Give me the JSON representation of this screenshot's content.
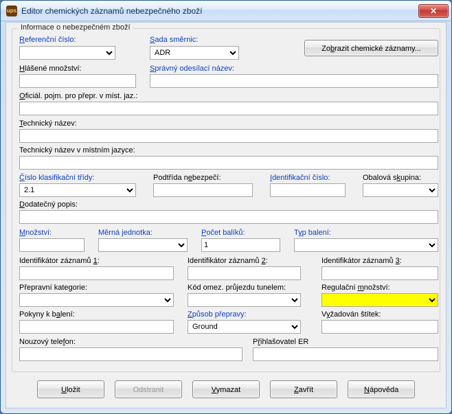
{
  "window": {
    "title": "Editor chemických záznamů nebezpečného zboží",
    "icon_text": "ups"
  },
  "group_legend": "Informace o nebezpečném zboží",
  "labels": {
    "ref_no": {
      "pre": "",
      "u": "R",
      "post": "eferenční číslo:"
    },
    "reg_set": {
      "pre": "",
      "u": "S",
      "post": "ada směrnic:"
    },
    "view_btn": {
      "pre": "Zo",
      "u": "b",
      "post": "razit chemické záznamy..."
    },
    "reported_qty": {
      "pre": "",
      "u": "H",
      "post": "lášené množství:"
    },
    "ship_name": {
      "pre": "",
      "u": "S",
      "post": "právný odesílací název:"
    },
    "local_name": "Oficiál. pojm. pro přepr. v míst. jaz.:",
    "tech_name": {
      "pre": "",
      "u": "T",
      "post": "echnický název:"
    },
    "tech_local": "Technický název v místním jazyce:",
    "class_no": {
      "pre": "",
      "u": "Č",
      "post": "íslo klasifikační třídy:"
    },
    "sub_risk": {
      "pre": "Podtřída n",
      "u": "e",
      "post": "bezpečí:"
    },
    "id_no": {
      "pre": "",
      "u": "I",
      "post": "dentifikační číslo:"
    },
    "pkg_group": {
      "pre": "Obalová s",
      "u": "k",
      "post": "upina:"
    },
    "add_desc": {
      "pre": "",
      "u": "D",
      "post": "odatečný popis:"
    },
    "qty": {
      "pre": "",
      "u": "M",
      "post": "nožství:"
    },
    "uom": {
      "pre": "Měrná ",
      "u": "j",
      "post": "ednotka:"
    },
    "pkg_count": {
      "pre": "",
      "u": "P",
      "post": "očet balíků:"
    },
    "pkg_type": {
      "pre": "T",
      "u": "y",
      "post": "p balení:"
    },
    "rec1": {
      "pre": "Identifikátor záznamů ",
      "u": "1",
      "post": ":"
    },
    "rec2": {
      "pre": "Identifikátor záznamů ",
      "u": "2",
      "post": ":"
    },
    "rec3": {
      "pre": "Identifikátor záznamů ",
      "u": "3",
      "post": ":"
    },
    "trans_cat": "Přepravní kategorie:",
    "tunnel": "Kód omez. průjezdu tunelem:",
    "reg_qty": {
      "pre": "Regulační ",
      "u": "m",
      "post": "nožství:"
    },
    "pack_instr": {
      "pre": "Pokyny k b",
      "u": "a",
      "post": "lení:"
    },
    "trans_mode": {
      "pre": "",
      "u": "Z",
      "post": "působ přepravy:"
    },
    "label_req": {
      "pre": "V",
      "u": "y",
      "post": "žadován štítek:"
    },
    "emerg_phone": {
      "pre": "Nouzový tele",
      "u": "f",
      "post": "on:"
    },
    "er_reg": {
      "pre": "P",
      "u": "ř",
      "post": "ihlašovatel ER"
    }
  },
  "values": {
    "ref_no": "",
    "reg_set": "ADR",
    "reported_qty": "",
    "ship_name": "",
    "local_name": "",
    "tech_name": "",
    "tech_local": "",
    "class_no": "2.1",
    "sub_risk": "",
    "id_no": "",
    "pkg_group": "",
    "add_desc": "",
    "qty": "",
    "uom": "",
    "pkg_count": "1",
    "pkg_type": "",
    "rec1": "",
    "rec2": "",
    "rec3": "",
    "trans_cat": "",
    "tunnel": "",
    "reg_qty": "",
    "pack_instr": "",
    "trans_mode": "Ground",
    "label_req": "",
    "emerg_phone": "",
    "er_reg": ""
  },
  "footer": {
    "save": {
      "pre": "",
      "u": "U",
      "post": "ložit"
    },
    "delete": {
      "pre": "",
      "u": "O",
      "post": "dstranit"
    },
    "clear": {
      "pre": "",
      "u": "V",
      "post": "ymazat"
    },
    "close": {
      "pre": "",
      "u": "Z",
      "post": "avřít"
    },
    "help": {
      "pre": "",
      "u": "N",
      "post": "ápověda"
    }
  }
}
